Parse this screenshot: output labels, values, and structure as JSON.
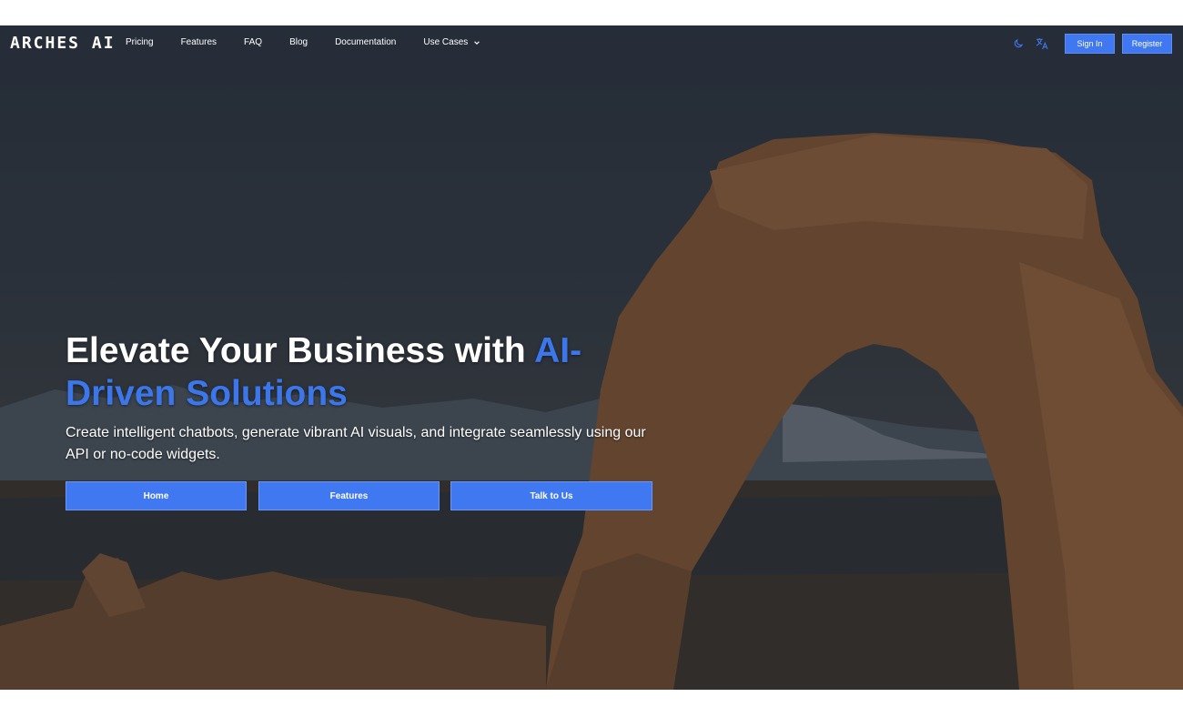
{
  "brand": {
    "logo_text": "ARCHES AI"
  },
  "nav": {
    "links": [
      "Pricing",
      "Features",
      "FAQ",
      "Blog",
      "Documentation"
    ],
    "use_cases_label": "Use Cases",
    "theme_icon": "moon-icon",
    "language_icon": "translate-icon",
    "sign_in_label": "Sign In",
    "register_label": "Register"
  },
  "hero": {
    "headline_plain": "Elevate Your Business with ",
    "headline_accent": "AI-Driven Solutions",
    "subtitle": "Create intelligent chatbots, generate vibrant AI visuals, and integrate seamlessly using our API or no-code widgets.",
    "buttons": [
      "Home",
      "Features",
      "Talk to Us"
    ]
  },
  "colors": {
    "accent": "#3f78f0",
    "accent_text": "#3b77ea",
    "overlay": "#2b3440"
  }
}
